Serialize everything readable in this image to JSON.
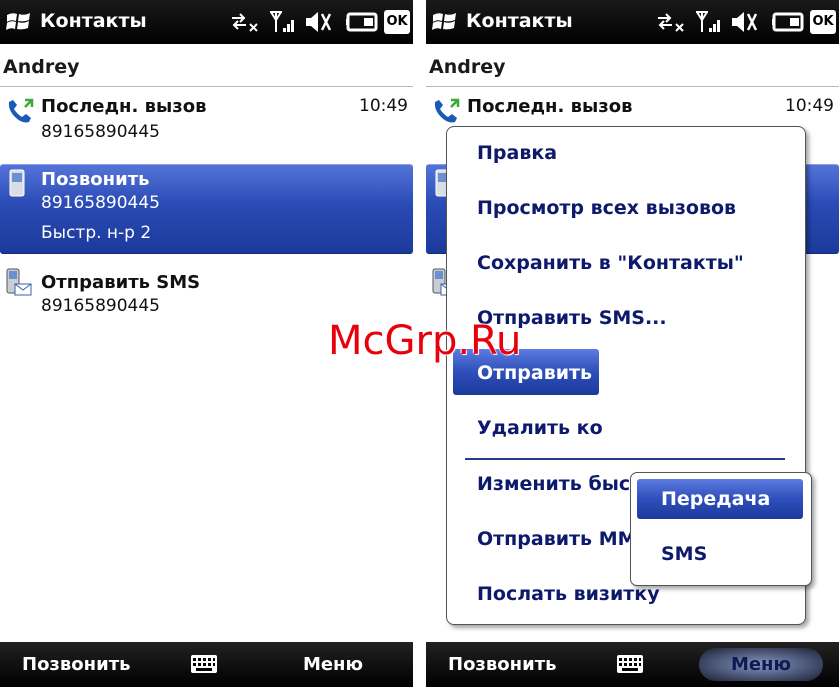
{
  "status_bar": {
    "title": "Контакты",
    "ok_label": "OK",
    "icons": [
      "windows-logo-icon",
      "data-sync-icon",
      "signal-icon",
      "speaker-mute-icon",
      "battery-icon"
    ]
  },
  "contact": {
    "name": "Andrey"
  },
  "rows": {
    "last_call": {
      "title": "Последн. вызов",
      "number": "89165890445",
      "time": "10:49"
    },
    "call": {
      "title": "Позвонить",
      "number": "89165890445",
      "speed_dial": "Быстр. н-р 2"
    },
    "sms": {
      "title": "Отправить SMS",
      "number": "89165890445"
    }
  },
  "softkeys": {
    "left": "Позвонить",
    "right": "Меню"
  },
  "menu": {
    "items": [
      "Правка",
      "Просмотр всех вызовов",
      "Сохранить в \"Контакты\"",
      "Отправить SMS...",
      "Отправить н",
      "Удалить ко",
      "Изменить быстрый набо ...",
      "Отправить MMS",
      "Послать визитку"
    ],
    "submenu": [
      "Передача",
      "SMS"
    ]
  },
  "watermark": "McGrp.Ru",
  "colors": {
    "selection": "#2a4bb5",
    "menu_text": "#0d1a6b",
    "watermark": "#e8000a",
    "bar": "#000000"
  }
}
